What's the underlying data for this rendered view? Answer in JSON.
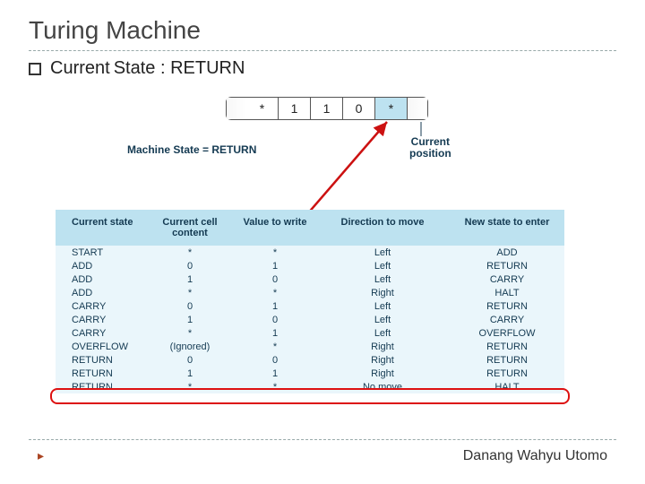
{
  "title": "Turing Machine",
  "subtitle_prefix": "Current",
  "subtitle_rest": " State : RETURN",
  "tape": {
    "cells": [
      "*",
      "1",
      "1",
      "0",
      "*"
    ],
    "highlight_index": 4
  },
  "state_label": "Machine State = RETURN",
  "curpos_label": "Current\nposition",
  "headers": [
    "Current state",
    "Current cell content",
    "Value to write",
    "Direction to move",
    "New state to enter"
  ],
  "rows": [
    [
      "START",
      "*",
      "*",
      "Left",
      "ADD"
    ],
    [
      "ADD",
      "0",
      "1",
      "Left",
      "RETURN"
    ],
    [
      "ADD",
      "1",
      "0",
      "Left",
      "CARRY"
    ],
    [
      "ADD",
      "*",
      "*",
      "Right",
      "HALT"
    ],
    [
      "CARRY",
      "0",
      "1",
      "Left",
      "RETURN"
    ],
    [
      "CARRY",
      "1",
      "0",
      "Left",
      "CARRY"
    ],
    [
      "CARRY",
      "*",
      "1",
      "Left",
      "OVERFLOW"
    ],
    [
      "OVERFLOW",
      "(Ignored)",
      "*",
      "Right",
      "RETURN"
    ],
    [
      "RETURN",
      "0",
      "0",
      "Right",
      "RETURN"
    ],
    [
      "RETURN",
      "1",
      "1",
      "Right",
      "RETURN"
    ],
    [
      "RETURN",
      "*",
      "*",
      "No move",
      "HALT"
    ]
  ],
  "highlight_row_index": 10,
  "footer": "Danang Wahyu Utomo"
}
